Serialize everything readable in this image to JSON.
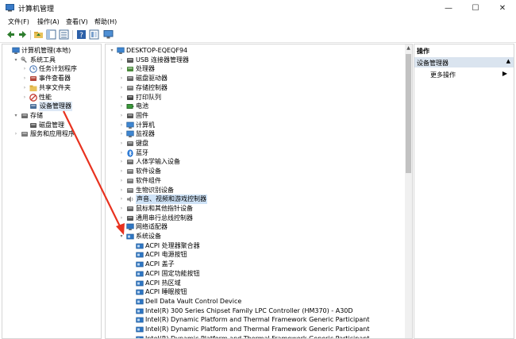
{
  "window": {
    "title": "计算机管理",
    "minimize": "—",
    "maximize": "☐",
    "close": "✕"
  },
  "menu": [
    "文件(F)",
    "操作(A)",
    "查看(V)",
    "帮助(H)"
  ],
  "toolbar": [
    "back-icon",
    "forward-icon",
    "folder-up-icon",
    "show-hide-tree-icon",
    "help-icon",
    "properties-icon",
    "monitor-icon"
  ],
  "left_tree": [
    {
      "label": "计算机管理(本地)",
      "icon": "computer-mgmt-icon",
      "level": 0,
      "expander": ""
    },
    {
      "label": "系统工具",
      "icon": "tools-icon",
      "level": 1,
      "expander": "▾"
    },
    {
      "label": "任务计划程序",
      "icon": "clock-icon",
      "level": 2,
      "expander": "›"
    },
    {
      "label": "事件查看器",
      "icon": "event-viewer-icon",
      "level": 2,
      "expander": "›"
    },
    {
      "label": "共享文件夹",
      "icon": "shared-folder-icon",
      "level": 2,
      "expander": "›"
    },
    {
      "label": "性能",
      "icon": "performance-icon",
      "level": 2,
      "expander": "›"
    },
    {
      "label": "设备管理器",
      "icon": "device-manager-icon",
      "level": 2,
      "expander": "",
      "selected": true
    },
    {
      "label": "存储",
      "icon": "storage-icon",
      "level": 1,
      "expander": "▾"
    },
    {
      "label": "磁盘管理",
      "icon": "disk-icon",
      "level": 2,
      "expander": ""
    },
    {
      "label": "服务和应用程序",
      "icon": "services-icon",
      "level": 1,
      "expander": "›"
    }
  ],
  "device_tree": [
    {
      "label": "DESKTOP-EQEQF94",
      "icon": "computer-icon",
      "level": 0,
      "expander": "▾"
    },
    {
      "label": "USB 连接器管理器",
      "icon": "usb-icon",
      "level": 1,
      "expander": "›"
    },
    {
      "label": "处理器",
      "icon": "cpu-icon",
      "level": 1,
      "expander": "›"
    },
    {
      "label": "磁盘驱动器",
      "icon": "disk-drive-icon",
      "level": 1,
      "expander": "›"
    },
    {
      "label": "存储控制器",
      "icon": "storage-controller-icon",
      "level": 1,
      "expander": "›"
    },
    {
      "label": "打印队列",
      "icon": "printer-icon",
      "level": 1,
      "expander": "›"
    },
    {
      "label": "电池",
      "icon": "battery-icon",
      "level": 1,
      "expander": "›"
    },
    {
      "label": "固件",
      "icon": "firmware-icon",
      "level": 1,
      "expander": "›"
    },
    {
      "label": "计算机",
      "icon": "computer-icon",
      "level": 1,
      "expander": "›"
    },
    {
      "label": "监视器",
      "icon": "monitor-icon",
      "level": 1,
      "expander": "›"
    },
    {
      "label": "键盘",
      "icon": "keyboard-icon",
      "level": 1,
      "expander": "›"
    },
    {
      "label": "蓝牙",
      "icon": "bluetooth-icon",
      "level": 1,
      "expander": "›"
    },
    {
      "label": "人体学输入设备",
      "icon": "hid-icon",
      "level": 1,
      "expander": "›"
    },
    {
      "label": "软件设备",
      "icon": "software-device-icon",
      "level": 1,
      "expander": "›"
    },
    {
      "label": "软件组件",
      "icon": "software-component-icon",
      "level": 1,
      "expander": "›"
    },
    {
      "label": "生物识别设备",
      "icon": "biometric-icon",
      "level": 1,
      "expander": "›"
    },
    {
      "label": "声音、视频和游戏控制器",
      "icon": "sound-icon",
      "level": 1,
      "expander": "›",
      "highlight": true
    },
    {
      "label": "鼠标和其他指针设备",
      "icon": "mouse-icon",
      "level": 1,
      "expander": "›"
    },
    {
      "label": "通用串行总线控制器",
      "icon": "usb-controller-icon",
      "level": 1,
      "expander": "›"
    },
    {
      "label": "网络适配器",
      "icon": "network-icon",
      "level": 1,
      "expander": "›"
    },
    {
      "label": "系统设备",
      "icon": "system-device-icon",
      "level": 1,
      "expander": "▾"
    },
    {
      "label": "ACPI 处理器聚合器",
      "icon": "system-device-icon",
      "level": 2,
      "expander": ""
    },
    {
      "label": "ACPI 电源按钮",
      "icon": "system-device-icon",
      "level": 2,
      "expander": ""
    },
    {
      "label": "ACPI 盖子",
      "icon": "system-device-icon",
      "level": 2,
      "expander": ""
    },
    {
      "label": "ACPI 固定功能按钮",
      "icon": "system-device-icon",
      "level": 2,
      "expander": ""
    },
    {
      "label": "ACPI 热区域",
      "icon": "system-device-icon",
      "level": 2,
      "expander": ""
    },
    {
      "label": "ACPI 睡眠按钮",
      "icon": "system-device-icon",
      "level": 2,
      "expander": ""
    },
    {
      "label": "Dell Data Vault Control Device",
      "icon": "system-device-icon",
      "level": 2,
      "expander": ""
    },
    {
      "label": "Intel(R) 300 Series Chipset Family LPC Controller (HM370) - A30D",
      "icon": "system-device-icon",
      "level": 2,
      "expander": ""
    },
    {
      "label": "Intel(R) Dynamic Platform and Thermal Framework Generic Participant",
      "icon": "system-device-icon",
      "level": 2,
      "expander": ""
    },
    {
      "label": "Intel(R) Dynamic Platform and Thermal Framework Generic Participant",
      "icon": "system-device-icon",
      "level": 2,
      "expander": ""
    },
    {
      "label": "Intel(R) Dynamic Platform and Thermal Framework Generic Participant",
      "icon": "system-device-icon",
      "level": 2,
      "expander": ""
    }
  ],
  "actions": {
    "header": "操作",
    "section": "设备管理器",
    "section_arrow": "▲",
    "item": "更多操作",
    "item_arrow": "▶"
  },
  "colors": {
    "selection": "#dde8f5",
    "highlight": "#cfe3f7",
    "actions_section": "#dae4ef",
    "annotation_arrow": "#e8321f"
  }
}
